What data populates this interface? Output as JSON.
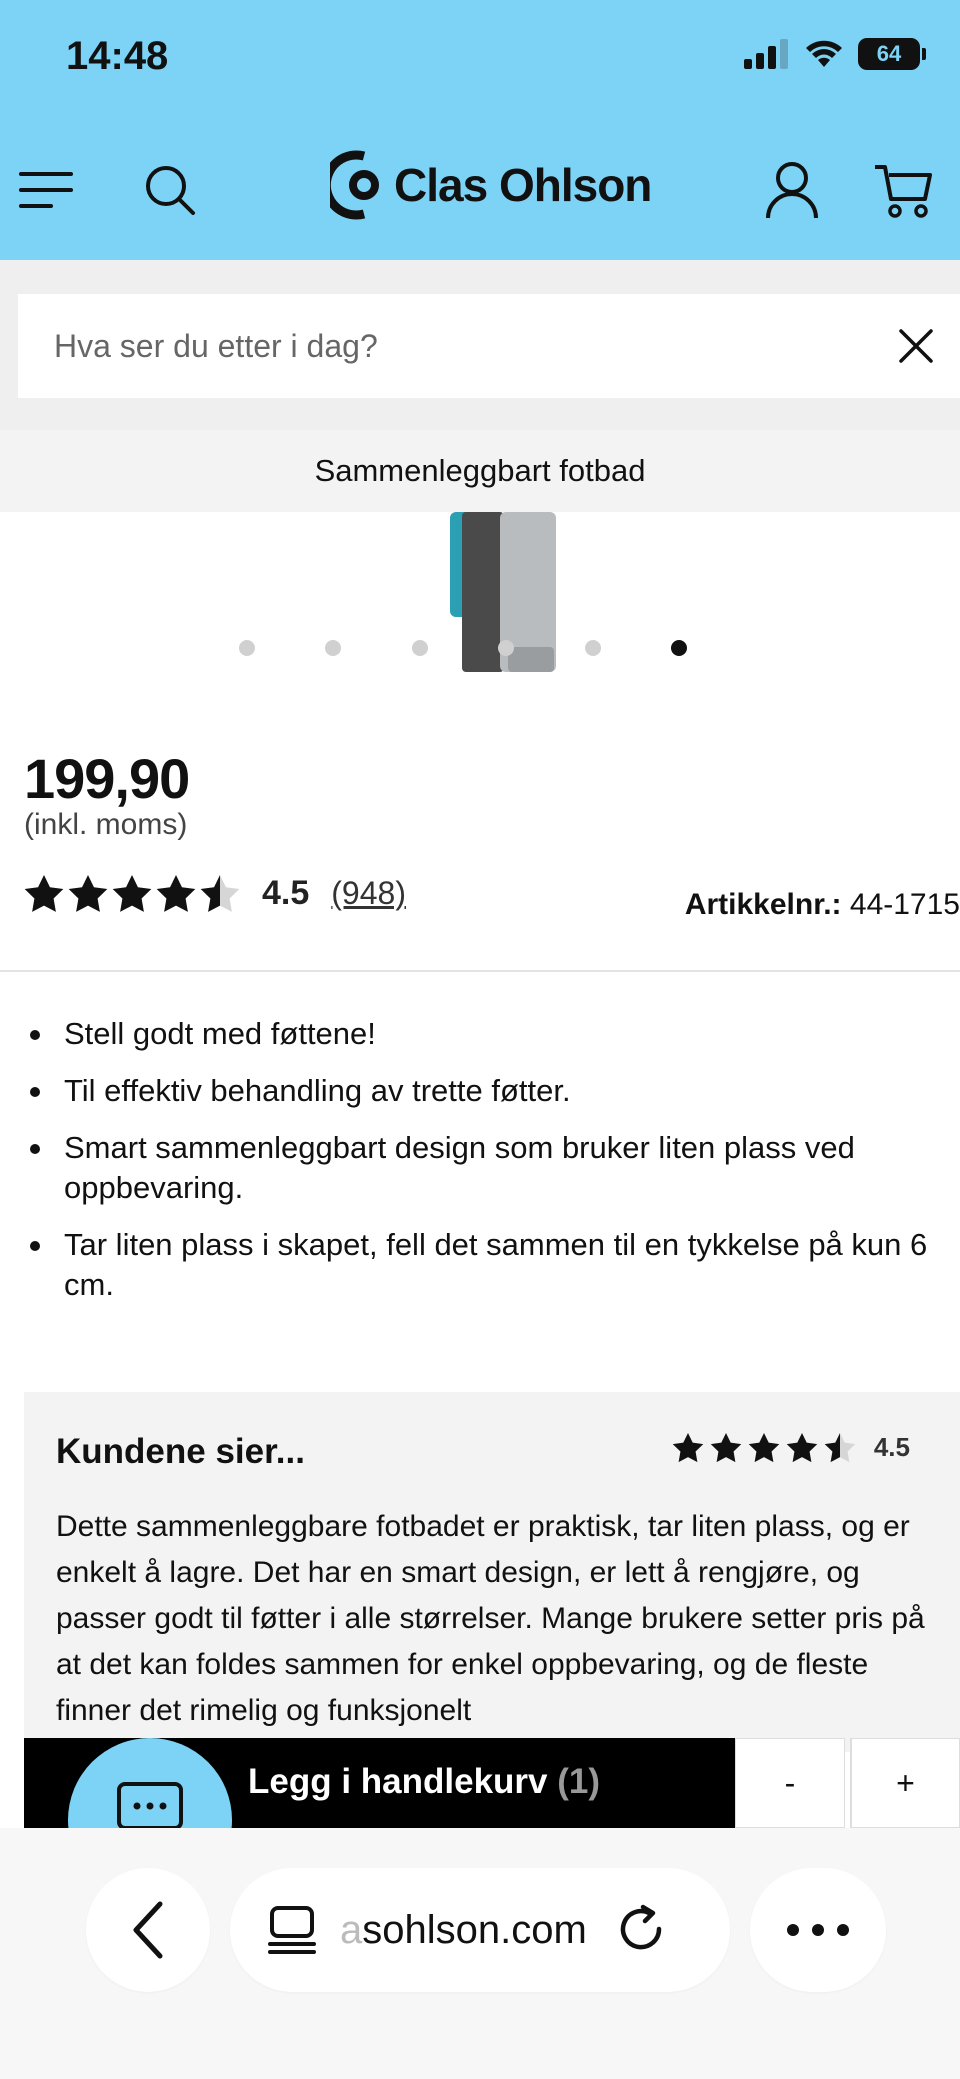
{
  "status_bar": {
    "time": "14:48",
    "battery": "64"
  },
  "header": {
    "brand": "Clas Ohlson"
  },
  "search": {
    "placeholder": "Hva ser du etter i dag?"
  },
  "product": {
    "title": "Sammenleggbart fotbad",
    "price": "199,90",
    "vat_note": "(inkl. moms)",
    "rating": 4.5,
    "rating_text": "4.5",
    "review_count": "(948)",
    "article_label": "Artikkelnr.:",
    "article_number": "44-1715",
    "carousel": {
      "total": 6,
      "active_index": 5
    },
    "bullets": [
      "Stell godt med føttene!",
      "Til effektiv behandling av trette føtter.",
      "Smart sammenleggbart design som bruker liten plass ved oppbevaring.",
      "Tar liten plass i skapet, fell det sammen til en tykkelse på kun 6 cm."
    ]
  },
  "reviews": {
    "title": "Kundene sier...",
    "score_text": "4.5",
    "summary": "Dette sammenleggbare fotbadet er praktisk, tar liten plass, og er enkelt å lagre. Det har en smart design, er lett å rengjøre, og passer godt til føtter i alle størrelser. Mange brukere setter pris på at det kan foldes sammen for enkel oppbevaring, og de fleste finner det rimelig og funksjonelt"
  },
  "cart": {
    "label": "Legg i handlekurv",
    "qty_text": "(1)",
    "minus": "-",
    "plus": "+"
  },
  "browser": {
    "url_faded": "a",
    "url": "sohlson.com"
  },
  "colors": {
    "accent": "#7dd3f5",
    "button": "#000000"
  }
}
